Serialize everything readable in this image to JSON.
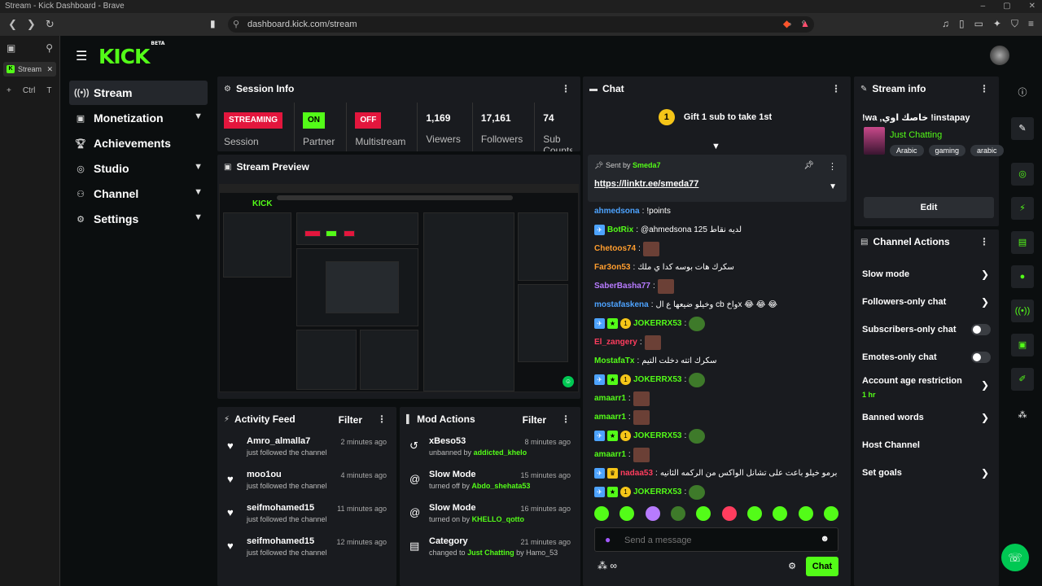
{
  "browser": {
    "window_title": "Stream - Kick Dashboard - Brave",
    "url": "dashboard.kick.com/stream",
    "tab_label": "Stream",
    "newtab_shortcut_ctrl": "Ctrl",
    "newtab_shortcut_key": "T"
  },
  "brand": {
    "logo": "KICK",
    "beta": "BETA",
    "accent": "#53fc18"
  },
  "nav": [
    {
      "label": "Stream",
      "icon": "broadcast-icon",
      "active": true
    },
    {
      "label": "Monetization",
      "icon": "money-icon",
      "chevron": true
    },
    {
      "label": "Achievements",
      "icon": "trophy-icon"
    },
    {
      "label": "Studio",
      "icon": "studio-icon",
      "chevron": true
    },
    {
      "label": "Channel",
      "icon": "users-icon",
      "chevron": true
    },
    {
      "label": "Settings",
      "icon": "gear-icon",
      "chevron": true
    }
  ],
  "session": {
    "title": "Session Info",
    "streaming_badge": "STREAMING",
    "session_label": "Session",
    "partner_badge": "ON",
    "partner_label": "Partner",
    "multistream_badge": "OFF",
    "multistream_label": "Multistream",
    "viewers_value": "1,169",
    "viewers_label": "Viewers",
    "followers_value": "17,161",
    "followers_label": "Followers",
    "subs_value": "74",
    "subs_label": "Sub Counts"
  },
  "preview": {
    "title": "Stream Preview"
  },
  "activity": {
    "title": "Activity Feed",
    "filter": "Filter",
    "items": [
      {
        "user": "Amro_almalla7",
        "text": "just followed the channel",
        "time": "2 minutes ago"
      },
      {
        "user": "moo1ou",
        "text": "just followed the channel",
        "time": "4 minutes ago"
      },
      {
        "user": "seifmohamed15",
        "text": "just followed the channel",
        "time": "11 minutes ago"
      },
      {
        "user": "seifmohamed15",
        "text": "just followed the channel",
        "time": "12 minutes ago"
      }
    ]
  },
  "mod": {
    "title": "Mod Actions",
    "filter": "Filter",
    "items": [
      {
        "title": "xBeso53",
        "prefix": "unbanned by",
        "by": "addicted_khelo",
        "suffix": "",
        "time": "8 minutes ago"
      },
      {
        "title": "Slow Mode",
        "prefix": "turned off by",
        "by": "Abdo_shehata53",
        "suffix": "",
        "time": "15 minutes ago"
      },
      {
        "title": "Slow Mode",
        "prefix": "turned on by",
        "by": "KHELLO_qotto",
        "suffix": "",
        "time": "16 minutes ago"
      },
      {
        "title": "Category",
        "prefix": "changed to",
        "by": "Just Chatting",
        "suffix": "by Hamo_53",
        "time": "21 minutes ago"
      }
    ]
  },
  "chat": {
    "title": "Chat",
    "gift": "Gift 1 sub to take 1st",
    "gift_number": "1",
    "pinned_sent_by": "Sent by",
    "pinned_user": "Smeda7",
    "pinned_link": "https://linktr.ee/smeda77",
    "messages": [
      {
        "user": "ahmedsona",
        "color": "#4da3ff",
        "text": "!points"
      },
      {
        "user": "BotRix",
        "color": "#53fc18",
        "text": "@ahmedsona لديه نقاط 125",
        "badge": "bot"
      },
      {
        "user": "Chetoos74",
        "color": "#ff9d2e",
        "text": "",
        "emote": true
      },
      {
        "user": "Far3on53",
        "color": "#ff9d2e",
        "text": "سكرك هات بوسه كدا ي ملك"
      },
      {
        "user": "SaberBasha77",
        "color": "#b77bff",
        "text": "",
        "emote": true
      },
      {
        "user": "mostafaskena",
        "color": "#4da3ff",
        "text": "وخيلو ضيعها ع ال cb واخx 😂 😂 😂"
      },
      {
        "user": "JOKERRX53",
        "color": "#53fc18",
        "text": "",
        "pepe": true,
        "badge": "sub"
      },
      {
        "user": "El_zangery",
        "color": "#ff3d5e",
        "text": "",
        "emote": true
      },
      {
        "user": "MostafaTx",
        "color": "#53fc18",
        "text": "سكرك اتته دخلت التيم"
      },
      {
        "user": "JOKERRX53",
        "color": "#53fc18",
        "text": "",
        "pepe": true,
        "badge": "sub"
      },
      {
        "user": "amaarr1",
        "color": "#53fc18",
        "text": "",
        "emote": true
      },
      {
        "user": "amaarr1",
        "color": "#53fc18",
        "text": "",
        "emote": true
      },
      {
        "user": "JOKERRX53",
        "color": "#53fc18",
        "text": "",
        "pepe": true,
        "badge": "sub"
      },
      {
        "user": "amaarr1",
        "color": "#53fc18",
        "text": "",
        "emote": true
      },
      {
        "user": "nadaa53",
        "color": "#ff3d5e",
        "text": "برمو خيلو باعت على تشانل الواكس من الركمه الثانيه",
        "badge": "crown"
      },
      {
        "user": "JOKERRX53",
        "color": "#53fc18",
        "text": "",
        "pepe": true,
        "badge": "sub"
      }
    ],
    "input_placeholder": "Send a message",
    "send_label": "Chat"
  },
  "stream_info": {
    "title": "Stream info",
    "stream_title": "!wa ,خاصك اوي !instapay",
    "category": "Just Chatting",
    "tags": [
      "Arabic",
      "gaming",
      "arabic"
    ],
    "edit_label": "Edit"
  },
  "channel_actions": {
    "title": "Channel Actions",
    "items": [
      {
        "label": "Slow mode",
        "type": "chevron"
      },
      {
        "label": "Followers-only chat",
        "type": "chevron"
      },
      {
        "label": "Subscribers-only chat",
        "type": "toggle"
      },
      {
        "label": "Emotes-only chat",
        "type": "toggle"
      },
      {
        "label": "Account age restriction",
        "sub": "1 hr",
        "type": "chevron"
      },
      {
        "label": "Banned words",
        "type": "chevron"
      },
      {
        "label": "Host Channel",
        "type": "none"
      },
      {
        "label": "Set goals",
        "type": "chevron"
      }
    ]
  }
}
